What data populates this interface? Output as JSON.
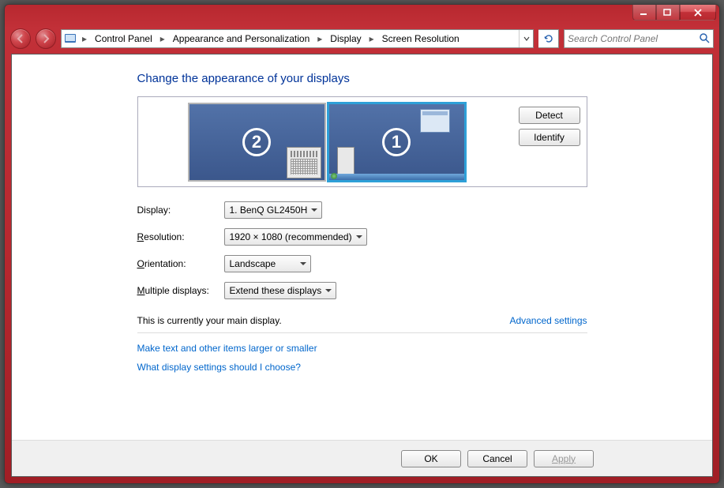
{
  "breadcrumb": {
    "items": [
      "Control Panel",
      "Appearance and Personalization",
      "Display",
      "Screen Resolution"
    ]
  },
  "search": {
    "placeholder": "Search Control Panel"
  },
  "heading": "Change the appearance of your displays",
  "monitors": {
    "num1": "1",
    "num2": "2"
  },
  "buttons": {
    "detect": "Detect",
    "identify": "Identify",
    "ok": "OK",
    "cancel": "Cancel",
    "apply": "Apply"
  },
  "form": {
    "display_label_prefix": "D",
    "display_label_rest": "isplay:",
    "display_value": "1. BenQ GL2450H",
    "resolution_label_prefix": "R",
    "resolution_label_rest": "esolution:",
    "resolution_value": "1920 × 1080 (recommended)",
    "orientation_label_prefix": "O",
    "orientation_label_rest": "rientation:",
    "orientation_value": "Landscape",
    "multiple_label_prefix": "M",
    "multiple_label_rest": "ultiple displays:",
    "multiple_value": "Extend these displays"
  },
  "status": {
    "main_display": "This is currently your main display.",
    "advanced": "Advanced settings"
  },
  "links": {
    "textsize": "Make text and other items larger or smaller",
    "help": "What display settings should I choose?"
  }
}
